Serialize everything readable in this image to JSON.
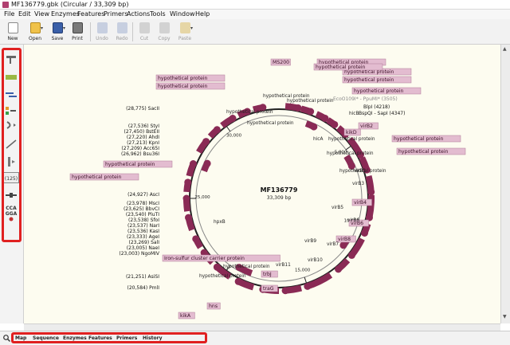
{
  "window": {
    "title": "MF136779.gbk  (Circular / 33,309 bp)"
  },
  "menu": [
    "File",
    "Edit",
    "View",
    "Enzymes",
    "Features",
    "Primers",
    "Actions",
    "Tools",
    "Window",
    "Help"
  ],
  "toolbar": [
    {
      "label": "New",
      "icon": "new-file-icon",
      "enabled": true
    },
    {
      "label": "Open",
      "icon": "open-folder-icon",
      "enabled": true
    },
    {
      "label": "Save",
      "icon": "save-disk-icon",
      "enabled": true
    },
    {
      "label": "Print",
      "icon": "printer-icon",
      "enabled": true
    },
    {
      "label": "Undo",
      "icon": "undo-icon",
      "enabled": false
    },
    {
      "label": "Redo",
      "icon": "redo-icon",
      "enabled": false
    },
    {
      "label": "Cut",
      "icon": "scissors-icon",
      "enabled": false
    },
    {
      "label": "Copy",
      "icon": "copy-icon",
      "enabled": false
    },
    {
      "label": "Paste",
      "icon": "paste-icon",
      "enabled": false
    }
  ],
  "side_tools": [
    {
      "icon": "restriction-enzymes-icon"
    },
    {
      "icon": "features-icon"
    },
    {
      "icon": "primers-icon"
    },
    {
      "icon": "orfs-icon"
    },
    {
      "icon": "translation-icon"
    },
    {
      "icon": "line-tool-icon"
    },
    {
      "icon": "enzyme-set-icon"
    },
    {
      "icon": "number-count-icon",
      "label": "(125)"
    },
    {
      "icon": "line-style-icon"
    },
    {
      "icon": "sequence-display-icon",
      "label": "CCA\nGGA"
    }
  ],
  "map": {
    "name": "MF136779",
    "length": "33,309 bp",
    "ticks": [
      "30,000",
      "25,000",
      "20,000",
      "15,000",
      "10,000",
      "5,000"
    ],
    "feature_labels_boxed": [
      "MS200",
      "hypothetical protein",
      "hypothetical protein",
      "hypothetical protein",
      "hypothetical protein",
      "hypothetical protein",
      "hypothetical protein",
      "hypothetical protein",
      "hypothetical protein",
      "hypothetical protein",
      "hypothetical protein",
      "Iron-sulfur cluster carrier protein",
      "hns",
      "kikA",
      "hypothetical protein",
      "traG",
      "virB4",
      "virB2",
      "virB6",
      "virB8",
      "trbJ",
      "kikD"
    ],
    "feature_labels_plain": [
      "hypothetical protein",
      "hypothetical protein",
      "hypothetical protein",
      "hypothetical protein",
      "hypothetical protein",
      "hypothetical protein",
      "hypothetical protein",
      "hypothetical protein",
      "hypothetical protein",
      "hicA",
      "hicB",
      "virB1",
      "virB3",
      "virB5",
      "virB9",
      "virB10",
      "virB11",
      "virB7",
      "virB6",
      "hpxB"
    ],
    "enzymes_left": [
      "(28,775)  SacII",
      "(27,536)  StyI",
      "(27,450)  BstEII",
      "(27,220)  AhdI",
      "(27,213)  KpnI",
      "(27,209)  Acc65I",
      "(26,962)  Bsu36I",
      "(24,927)  AscI",
      "(23,978)  MscI",
      "(23,625)  BbvCI",
      "(23,540)  PluTI",
      "(23,538)  SfoI",
      "(23,537)  NarI",
      "(23,536)  KasI",
      "(23,333)  AgeI",
      "(23,269)  SalI",
      "(23,005)  NaeI",
      "(23,003)  NgoMIV",
      "(21,251)  AsiSI",
      "(20,584)  PmlI"
    ],
    "enzymes_right": [
      "EcoO109I* - PpuMI*  (3505)",
      "BlpI  (4218)",
      "BspQI - SapI  (4347)"
    ]
  },
  "bottom_tabs": [
    "Map",
    "Sequence",
    "Enzymes",
    "Features",
    "Primers",
    "History"
  ],
  "colors": {
    "feature": "#8a2a55",
    "label_box": "#e3bcd0",
    "canvas": "#fdfcf0",
    "highlight": "#e02020"
  }
}
